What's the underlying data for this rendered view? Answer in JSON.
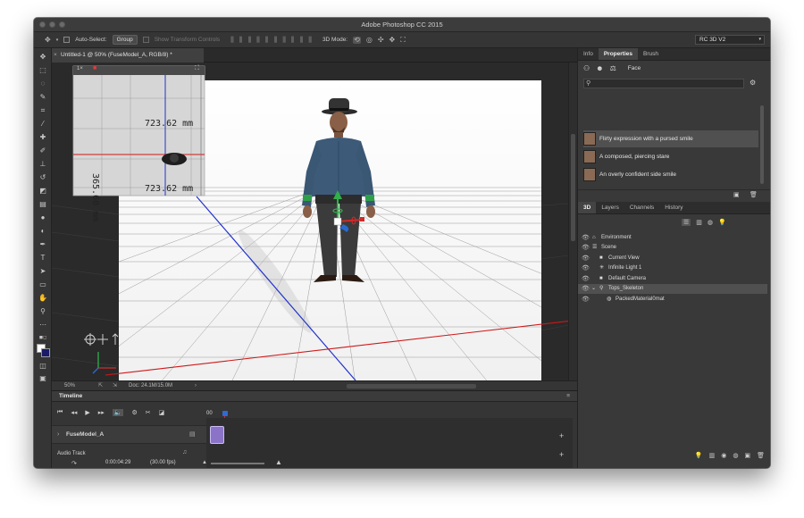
{
  "window": {
    "title": "Adobe Photoshop CC 2015"
  },
  "options_bar": {
    "auto_select_label": "Auto-Select:",
    "auto_select_value": "Group",
    "show_transform_controls": "Show Transform Controls",
    "mode_label": "3D Mode:",
    "workspace": "RC 3D V2"
  },
  "document": {
    "tab_title": "Untitled-1 @ 50% (FuseModel_A, RGB/8) *",
    "zoom": "50%",
    "doc_info": "Doc: 24.1M/15.0M"
  },
  "secondary_view": {
    "measure_top": "723.62 mm",
    "measure_side": "365.60 mm",
    "measure_bottom": "723.62 mm"
  },
  "properties_panel": {
    "tabs": [
      "Info",
      "Properties",
      "Brush"
    ],
    "active_tab": "Properties",
    "mode_label": "Face",
    "expressions": [
      "Flirty expression with a pursed smile",
      "A composed, piercing stare",
      "An overly confident side smile"
    ]
  },
  "layers_panel": {
    "tabs": [
      "3D",
      "Layers",
      "Channels",
      "History"
    ],
    "active_tab": "3D",
    "items": [
      "Environment",
      "Scene",
      "Current View",
      "Infinite Light 1",
      "Default Camera",
      "Tops_Skeleton",
      "PackedMaterial0mat"
    ]
  },
  "timeline": {
    "title": "Timeline",
    "frame_marker": "00",
    "track_name": "FuseModel_A",
    "audio_label": "Audio Track",
    "timecode": "0:00:04:29",
    "fps": "(30.00 fps)"
  },
  "colors": {
    "accent": "#2f6bd6",
    "selected_row": "#505050",
    "clip": "#8b74c7"
  }
}
